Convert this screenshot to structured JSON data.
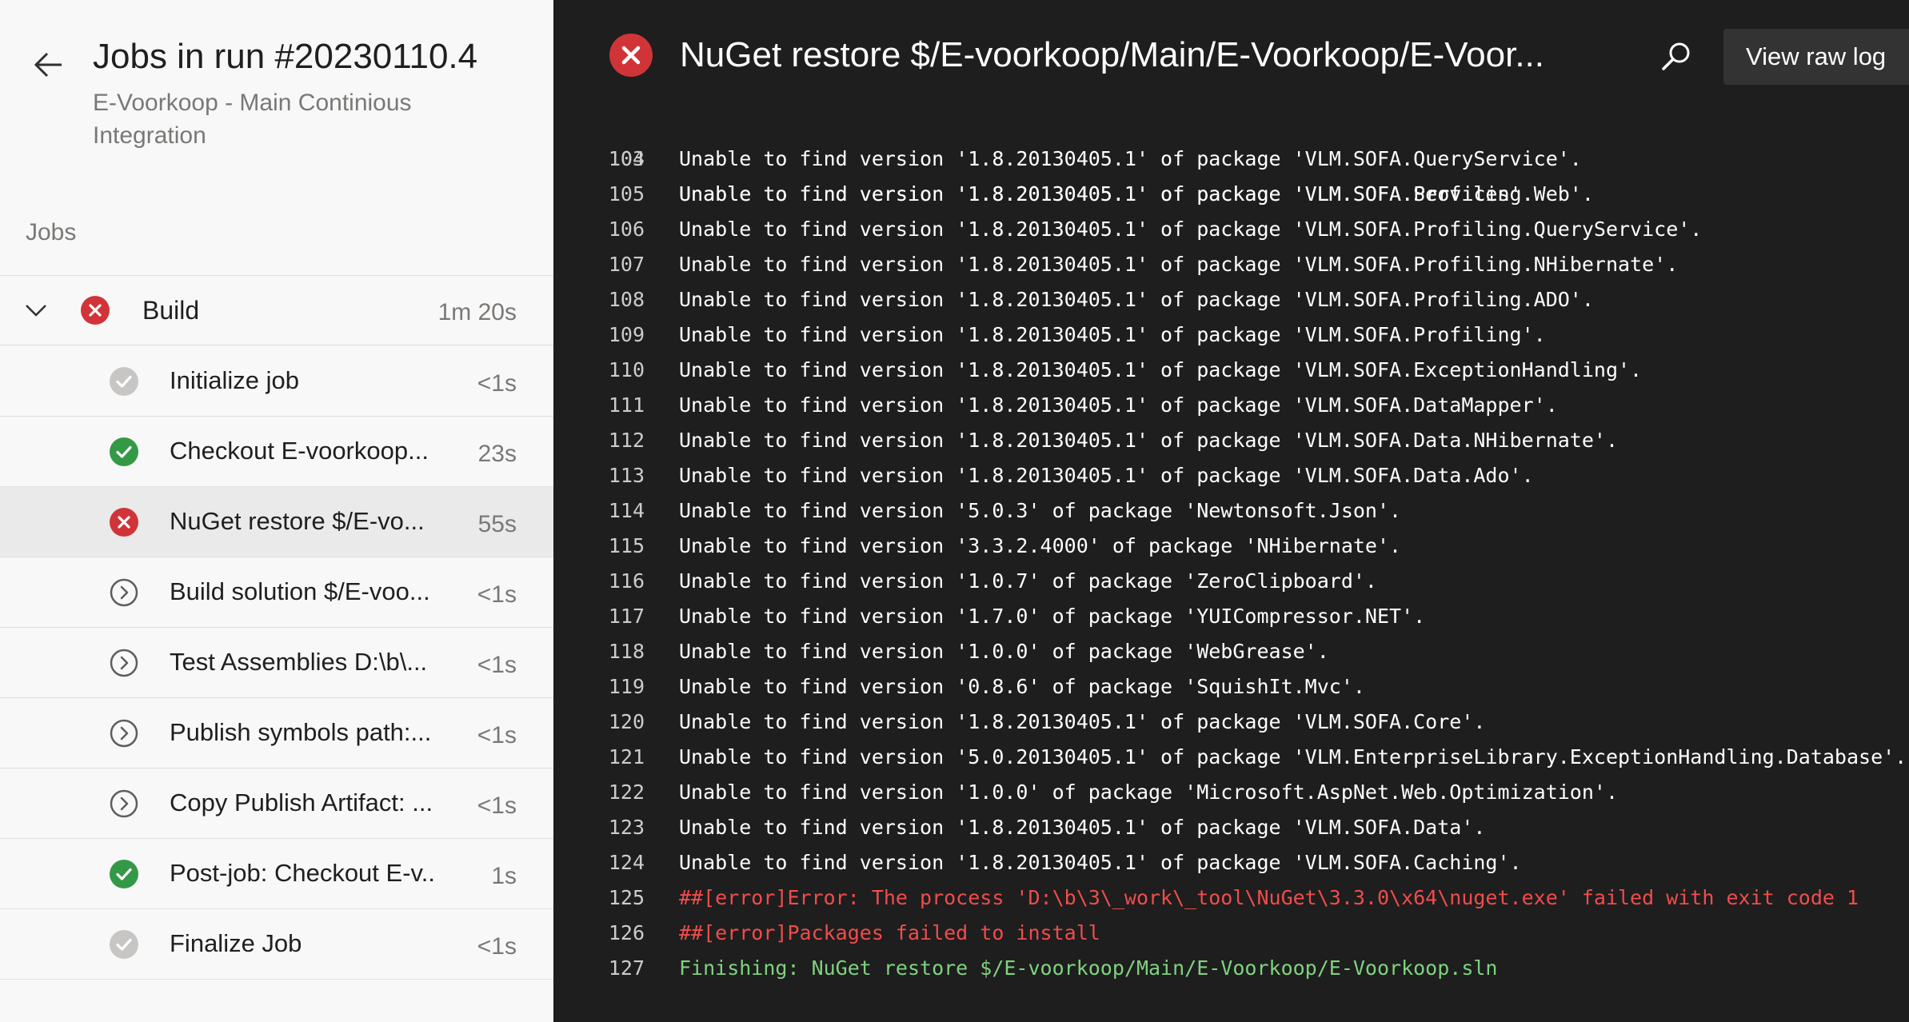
{
  "sidebar": {
    "title": "Jobs in run #20230110.4",
    "subtitle": "E-Voorkoop - Main Continious Integration",
    "jobs_label": "Jobs",
    "build": {
      "name": "Build",
      "duration": "1m 20s",
      "status": "failed"
    },
    "steps": [
      {
        "name": "Initialize job",
        "duration": "<1s",
        "status": "success-gray"
      },
      {
        "name": "Checkout E-voorkoop...",
        "duration": "23s",
        "status": "success"
      },
      {
        "name": "NuGet restore $/E-vo...",
        "duration": "55s",
        "status": "failed",
        "selected": true
      },
      {
        "name": "Build solution $/E-voo...",
        "duration": "<1s",
        "status": "skipped"
      },
      {
        "name": "Test Assemblies D:\\b\\...",
        "duration": "<1s",
        "status": "skipped"
      },
      {
        "name": "Publish symbols path:...",
        "duration": "<1s",
        "status": "skipped"
      },
      {
        "name": "Copy Publish Artifact: ...",
        "duration": "<1s",
        "status": "skipped"
      },
      {
        "name": "Post-job: Checkout E-v...",
        "duration": "1s",
        "status": "success"
      },
      {
        "name": "Finalize Job",
        "duration": "<1s",
        "status": "success-gray"
      }
    ]
  },
  "log": {
    "title": "NuGet restore $/E-voorkoop/Main/E-Voorkoop/E-Voor...",
    "view_raw_label": "View raw log",
    "partial_line": "Unable to find version '1.8.20130405.1' of package 'VLM.SOFA.Services'.",
    "lines": [
      {
        "num": "104",
        "text": "Unable to find version '1.8.20130405.1' of package 'VLM.SOFA.QueryService'.",
        "kind": "normal"
      },
      {
        "num": "105",
        "text": "Unable to find version '1.8.20130405.1' of package 'VLM.SOFA.Profiling.Web'.",
        "kind": "normal"
      },
      {
        "num": "106",
        "text": "Unable to find version '1.8.20130405.1' of package 'VLM.SOFA.Profiling.QueryService'.",
        "kind": "normal"
      },
      {
        "num": "107",
        "text": "Unable to find version '1.8.20130405.1' of package 'VLM.SOFA.Profiling.NHibernate'.",
        "kind": "normal"
      },
      {
        "num": "108",
        "text": "Unable to find version '1.8.20130405.1' of package 'VLM.SOFA.Profiling.ADO'.",
        "kind": "normal"
      },
      {
        "num": "109",
        "text": "Unable to find version '1.8.20130405.1' of package 'VLM.SOFA.Profiling'.",
        "kind": "normal"
      },
      {
        "num": "110",
        "text": "Unable to find version '1.8.20130405.1' of package 'VLM.SOFA.ExceptionHandling'.",
        "kind": "normal"
      },
      {
        "num": "111",
        "text": "Unable to find version '1.8.20130405.1' of package 'VLM.SOFA.DataMapper'.",
        "kind": "normal"
      },
      {
        "num": "112",
        "text": "Unable to find version '1.8.20130405.1' of package 'VLM.SOFA.Data.NHibernate'.",
        "kind": "normal"
      },
      {
        "num": "113",
        "text": "Unable to find version '1.8.20130405.1' of package 'VLM.SOFA.Data.Ado'.",
        "kind": "normal"
      },
      {
        "num": "114",
        "text": "Unable to find version '5.0.3' of package 'Newtonsoft.Json'.",
        "kind": "normal"
      },
      {
        "num": "115",
        "text": "Unable to find version '3.3.2.4000' of package 'NHibernate'.",
        "kind": "normal"
      },
      {
        "num": "116",
        "text": "Unable to find version '1.0.7' of package 'ZeroClipboard'.",
        "kind": "normal"
      },
      {
        "num": "117",
        "text": "Unable to find version '1.7.0' of package 'YUICompressor.NET'.",
        "kind": "normal"
      },
      {
        "num": "118",
        "text": "Unable to find version '1.0.0' of package 'WebGrease'.",
        "kind": "normal"
      },
      {
        "num": "119",
        "text": "Unable to find version '0.8.6' of package 'SquishIt.Mvc'.",
        "kind": "normal"
      },
      {
        "num": "120",
        "text": "Unable to find version '1.8.20130405.1' of package 'VLM.SOFA.Core'.",
        "kind": "normal"
      },
      {
        "num": "121",
        "text": "Unable to find version '5.0.20130405.1' of package 'VLM.EnterpriseLibrary.ExceptionHandling.Database'.",
        "kind": "normal"
      },
      {
        "num": "122",
        "text": "Unable to find version '1.0.0' of package 'Microsoft.AspNet.Web.Optimization'.",
        "kind": "normal"
      },
      {
        "num": "123",
        "text": "Unable to find version '1.8.20130405.1' of package 'VLM.SOFA.Data'.",
        "kind": "normal"
      },
      {
        "num": "124",
        "text": "Unable to find version '1.8.20130405.1' of package 'VLM.SOFA.Caching'.",
        "kind": "normal"
      },
      {
        "num": "125",
        "text": "##[error]Error: The process 'D:\\b\\3\\_work\\_tool\\NuGet\\3.3.0\\x64\\nuget.exe' failed with exit code 1",
        "kind": "error"
      },
      {
        "num": "126",
        "text": "##[error]Packages failed to install",
        "kind": "error"
      },
      {
        "num": "127",
        "text": "Finishing: NuGet restore $/E-voorkoop/Main/E-Voorkoop/E-Voorkoop.sln",
        "kind": "finish"
      }
    ]
  },
  "colors": {
    "failed": "#d13438",
    "success": "#339947",
    "success_gray": "#c8c6c4",
    "skipped": "#605e5c",
    "log_bg": "#1e1e1e",
    "error_text": "#f14c4c",
    "finish_text": "#7ed37e"
  }
}
